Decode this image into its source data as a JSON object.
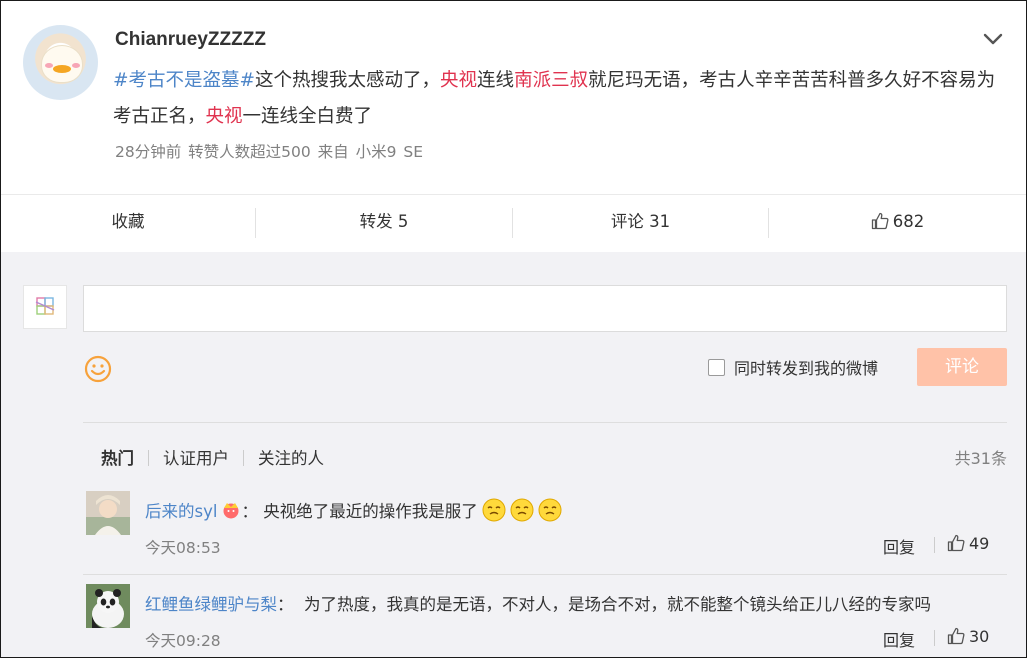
{
  "post": {
    "username": "ChianrueyZZZZZ",
    "text_segments": [
      {
        "text": "#考古不是盗墓#",
        "style": "blue"
      },
      {
        "text": "这个热搜我太感动了，",
        "style": "plain"
      },
      {
        "text": "央视",
        "style": "red"
      },
      {
        "text": "连线",
        "style": "plain"
      },
      {
        "text": "南派三叔",
        "style": "red"
      },
      {
        "text": "就尼玛无语，考古人辛辛苦苦科普多久好不容易为考古正名，",
        "style": "plain"
      },
      {
        "text": "央视",
        "style": "red"
      },
      {
        "text": "一连线全白费了",
        "style": "plain"
      }
    ],
    "meta": "28分钟前  转赞人数超过500  来自 小米9 SE"
  },
  "actions": {
    "favorite": "收藏",
    "repost": "转发 5",
    "comment": "评论 31",
    "like_count": "682"
  },
  "composer": {
    "input_value": "",
    "repost_label": "同时转发到我的微博",
    "repost_checked": false,
    "submit_label": "评论"
  },
  "tabs": [
    "热门",
    "认证用户",
    "关注的人"
  ],
  "active_tab": "热门",
  "total": "共31条",
  "comments": [
    {
      "name": "后来的syl",
      "separator": "：",
      "text": "央视绝了最近的操作我是服了",
      "time": "今天08:53",
      "reply": "回复",
      "likes": "49"
    },
    {
      "name": "红鲤鱼绿鲤驴与梨",
      "separator": "：",
      "text": "为了热度，我真的是无语，不对人，是场合不对，就不能整个镜头给正儿八经的专家吗",
      "time": "今天09:28",
      "reply": "回复",
      "likes": "30"
    }
  ],
  "colors": {
    "link_blue": "#4d85c8",
    "highlight_red": "#e0334f",
    "submit_button": "#ffc2a8",
    "comments_bg": "#f2f2f5",
    "smiley_orange": "#f7a23b"
  },
  "icons": {
    "expand": "chevron-down-icon",
    "like": "thumbs-up-icon",
    "emoji_picker": "smiley-icon",
    "badge": "crown-icon"
  }
}
